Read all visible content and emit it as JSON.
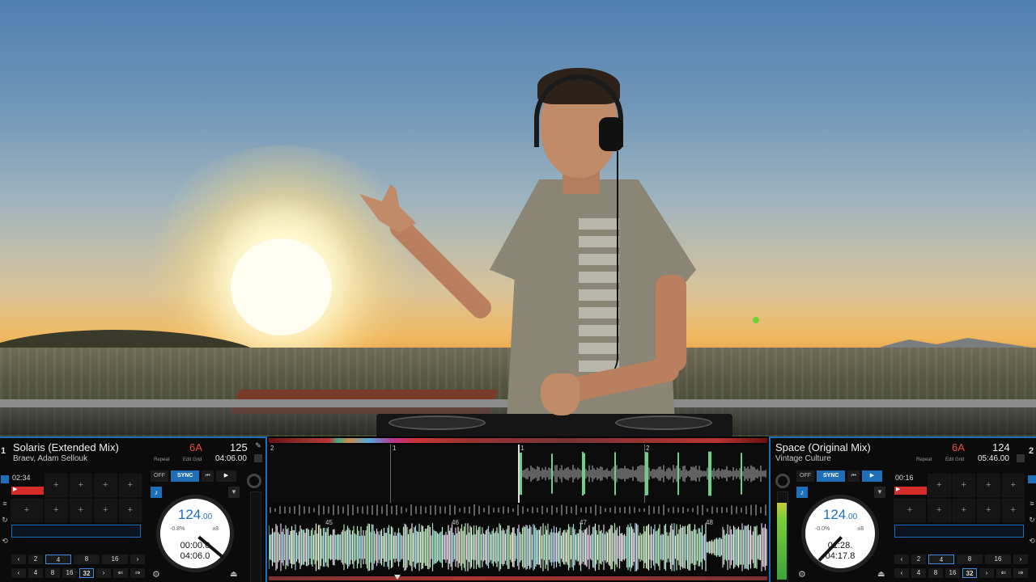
{
  "deck_left": {
    "number": "1",
    "title": "Solaris (Extended Mix)",
    "artist": "Braev, Adam Sellouk",
    "key": "6A",
    "bpm": "125",
    "repeat_label": "Repeat",
    "edit_grid_label": "Edit Grid",
    "total_time": "04:06.00",
    "loop_readout": "02:34",
    "off_label": "OFF",
    "sync_label": "SYNC",
    "jog_bpm": "124",
    "jog_bpm_dec": ".00",
    "pitch": "-0.8%",
    "pitch_range": "±8",
    "elapsed": "00:00.0",
    "remaining": "04:06.0",
    "beat_sizes_top": [
      "2",
      "4",
      "8",
      "16"
    ],
    "beat_sizes_bottom": [
      "4",
      "8",
      "16",
      "32"
    ],
    "position_fraction": 0.0
  },
  "deck_right": {
    "number": "2",
    "title": "Space (Original Mix)",
    "artist": "Vintage Culture",
    "key": "6A",
    "bpm": "124",
    "repeat_label": "Repeat",
    "edit_grid_label": "Edit Grid",
    "total_time": "05:46.00",
    "loop_readout": "00:16",
    "off_label": "OFF",
    "sync_label": "SYNC",
    "jog_bpm": "124",
    "jog_bpm_dec": ".00",
    "pitch": "-0.0%",
    "pitch_range": "±8",
    "elapsed": "01:28.",
    "remaining": "04:17.8",
    "beat_sizes_top": [
      "2",
      "4",
      "8",
      "16"
    ],
    "beat_sizes_bottom": [
      "4",
      "8",
      "16",
      "32"
    ],
    "position_fraction": 0.26
  },
  "waveform": {
    "upper_beat_labels": [
      "2",
      "1",
      "1",
      "2"
    ],
    "lower_beat_labels": [
      "45",
      "46",
      "47",
      "48"
    ]
  },
  "icons": {
    "pad_plus": "+",
    "play": "▶",
    "cue": "⏮",
    "dropdown": "▼",
    "note": "♪",
    "eject": "⏏",
    "settings": "✎",
    "prev": "‹",
    "next": "›"
  },
  "colors": {
    "accent": "#1f6fb8",
    "key": "#e84c3d",
    "record": "#d62b2b"
  }
}
